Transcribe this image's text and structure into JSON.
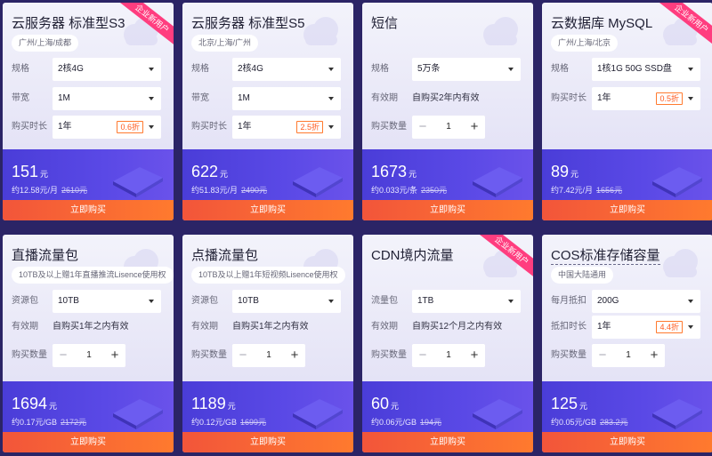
{
  "cards": [
    {
      "title": "云服务器 标准型S3",
      "badge": "企业新用户",
      "region": "广州/上海/成都",
      "rows": {
        "spec": {
          "label": "规格",
          "value": "2核4G"
        },
        "bandwidth": {
          "label": "带宽",
          "value": "1M"
        },
        "duration": {
          "label": "购买时长",
          "value": "1年",
          "discount": "0.6折"
        }
      },
      "price": "151",
      "unit": "元",
      "per": "约12.58元/月",
      "original": "2610元",
      "buy_label": "立即购买"
    },
    {
      "title": "云服务器 标准型S5",
      "region": "北京/上海/广州",
      "rows": {
        "spec": {
          "label": "规格",
          "value": "2核4G"
        },
        "bandwidth": {
          "label": "带宽",
          "value": "1M"
        },
        "duration": {
          "label": "购买时长",
          "value": "1年",
          "discount": "2.5折"
        }
      },
      "price": "622",
      "unit": "元",
      "per": "约51.83元/月",
      "original": "2490元",
      "buy_label": "立即购买"
    },
    {
      "title": "短信",
      "rows": {
        "spec": {
          "label": "规格",
          "value": "5万条"
        },
        "validity": {
          "label": "有效期",
          "value": "自购买2年内有效"
        },
        "quantity": {
          "label": "购买数量",
          "value": "1",
          "minus": "−",
          "plus": "+"
        }
      },
      "price": "1673",
      "unit": "元",
      "per": "约0.033元/条",
      "original": "2350元",
      "buy_label": "立即购买"
    },
    {
      "title": "云数据库 MySQL",
      "badge": "企业新用户",
      "region": "广州/上海/北京",
      "rows": {
        "spec": {
          "label": "规格",
          "value": "1核1G 50G SSD盘"
        },
        "duration": {
          "label": "购买时长",
          "value": "1年",
          "discount": "0.5折"
        }
      },
      "price": "89",
      "unit": "元",
      "per": "约7.42元/月",
      "original": "1656元",
      "buy_label": "立即购买"
    },
    {
      "title": "直播流量包",
      "region": "10TB及以上赠1年直播推流Lisence使用权",
      "rows": {
        "package": {
          "label": "资源包",
          "value": "10TB"
        },
        "validity": {
          "label": "有效期",
          "value": "自购买1年之内有效"
        },
        "quantity": {
          "label": "购买数量",
          "value": "1",
          "minus": "−",
          "plus": "+"
        }
      },
      "price": "1694",
      "unit": "元",
      "per": "约0.17元/GB",
      "original": "2172元",
      "buy_label": "立即购买"
    },
    {
      "title": "点播流量包",
      "region": "10TB及以上赠1年短视频Lisence使用权",
      "rows": {
        "package": {
          "label": "资源包",
          "value": "10TB"
        },
        "validity": {
          "label": "有效期",
          "value": "自购买1年之内有效"
        },
        "quantity": {
          "label": "购买数量",
          "value": "1",
          "minus": "−",
          "plus": "+"
        }
      },
      "price": "1189",
      "unit": "元",
      "per": "约0.12元/GB",
      "original": "1699元",
      "buy_label": "立即购买"
    },
    {
      "title": "CDN境内流量",
      "badge": "企业新用户",
      "rows": {
        "package": {
          "label": "流量包",
          "value": "1TB"
        },
        "validity": {
          "label": "有效期",
          "value": "自购买12个月之内有效"
        },
        "quantity": {
          "label": "购买数量",
          "value": "1",
          "minus": "−",
          "plus": "+"
        }
      },
      "price": "60",
      "unit": "元",
      "per": "约0.06元/GB",
      "original": "194元",
      "buy_label": "立即购买"
    },
    {
      "title": "COS标准存储容量",
      "region": "中国大陆通用",
      "rows": {
        "monthly": {
          "label": "每月抵扣",
          "value": "200G"
        },
        "deduct": {
          "label": "抵扣时长",
          "value": "1年",
          "discount": "4.4折"
        },
        "quantity": {
          "label": "购买数量",
          "value": "1",
          "minus": "−",
          "plus": "+"
        }
      },
      "price": "125",
      "unit": "元",
      "per": "约0.05元/GB",
      "original": "283.2元",
      "buy_label": "立即购买"
    }
  ],
  "colors": {
    "page_bg": "#2b2466",
    "price_band": "#4a3dd8",
    "buy_button": "#f2553a",
    "badge": "#ff3d7f",
    "discount": "#ff5a1f"
  },
  "icons": {
    "cloud": "cloud-decor-icon",
    "caret": "chevron-down-icon",
    "server": "server-decor-icon"
  }
}
